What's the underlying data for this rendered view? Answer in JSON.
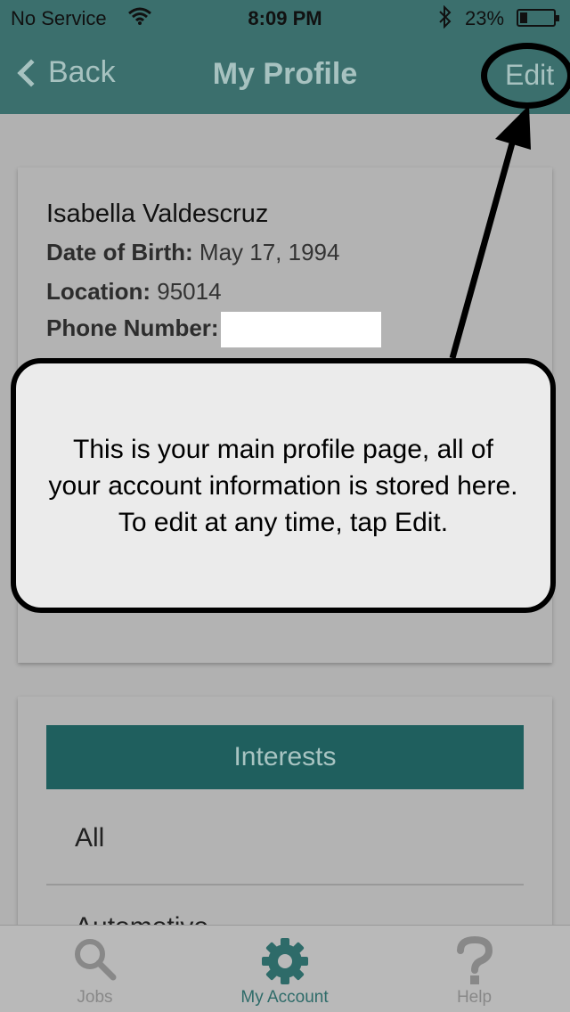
{
  "status_bar": {
    "carrier": "No Service",
    "time": "8:09 PM",
    "battery": "23%"
  },
  "nav": {
    "back": "Back",
    "title": "My Profile",
    "edit": "Edit"
  },
  "profile": {
    "name": "Isabella Valdescruz",
    "dob_label": "Date of Birth:",
    "dob": "May 17, 1994",
    "location_label": "Location:",
    "location": "95014",
    "phone_label": "Phone Number:"
  },
  "interests": {
    "header": "Interests",
    "items": [
      "All",
      "Automotive"
    ]
  },
  "tutorial": {
    "line1": "This is your main profile page, all of",
    "line2": "your account information is stored here.",
    "line3": "To edit at any time, tap Edit."
  },
  "tabs": [
    {
      "label": "Jobs",
      "icon": "search-icon"
    },
    {
      "label": "My Account",
      "icon": "gear-icon"
    },
    {
      "label": "Help",
      "icon": "question-icon"
    }
  ],
  "colors": {
    "header": "#3b6f6d",
    "accent": "#1f5f5e",
    "active_tab": "#2e6b69"
  }
}
